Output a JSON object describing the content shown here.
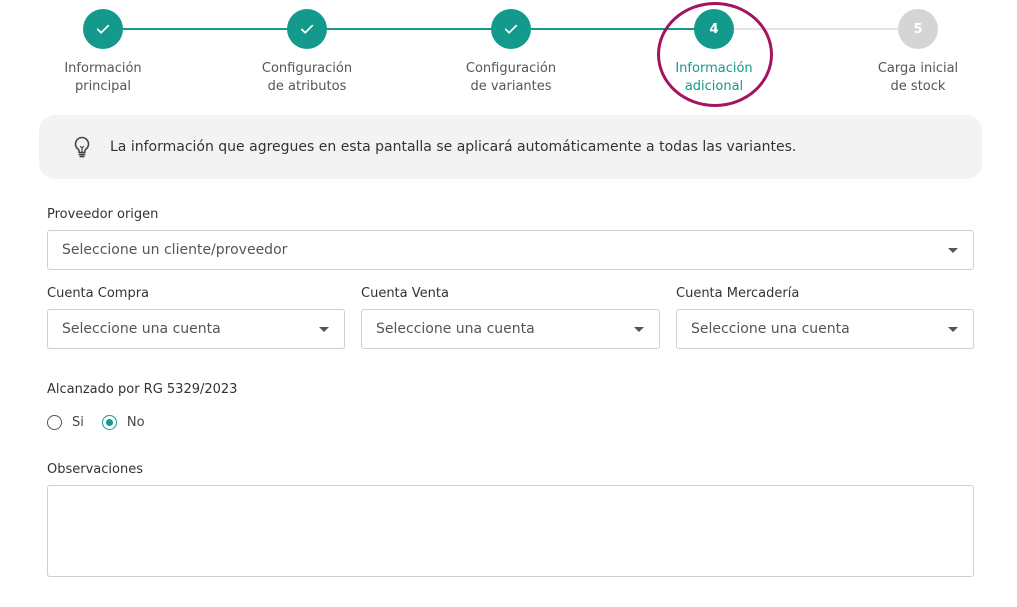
{
  "stepper": {
    "steps": [
      {
        "line1": "Información",
        "line2": "principal",
        "state": "done",
        "number": ""
      },
      {
        "line1": "Configuración",
        "line2": "de atributos",
        "state": "done",
        "number": ""
      },
      {
        "line1": "Configuración",
        "line2": "de variantes",
        "state": "done",
        "number": ""
      },
      {
        "line1": "Información",
        "line2": "adicional",
        "state": "active",
        "number": "4"
      },
      {
        "line1": "Carga inicial",
        "line2": "de stock",
        "state": "pending",
        "number": "5"
      }
    ],
    "colors": {
      "done": "#139a8c",
      "pending": "#d5d5d5",
      "highlight": "#a3135f"
    }
  },
  "banner": {
    "icon": "lightbulb-icon",
    "text": "La información que agregues en esta pantalla se aplicará automáticamente a todas las variantes."
  },
  "form": {
    "proveedor": {
      "label": "Proveedor origen",
      "placeholder": "Seleccione un cliente/proveedor"
    },
    "cuenta_compra": {
      "label": "Cuenta Compra",
      "placeholder": "Seleccione una cuenta"
    },
    "cuenta_venta": {
      "label": "Cuenta Venta",
      "placeholder": "Seleccione una cuenta"
    },
    "cuenta_mercaderia": {
      "label": "Cuenta Mercadería",
      "placeholder": "Seleccione una cuenta"
    },
    "rg": {
      "label": "Alcanzado por RG 5329/2023",
      "options": [
        "Si",
        "No"
      ],
      "selected": "No"
    },
    "observaciones": {
      "label": "Observaciones",
      "value": ""
    }
  }
}
